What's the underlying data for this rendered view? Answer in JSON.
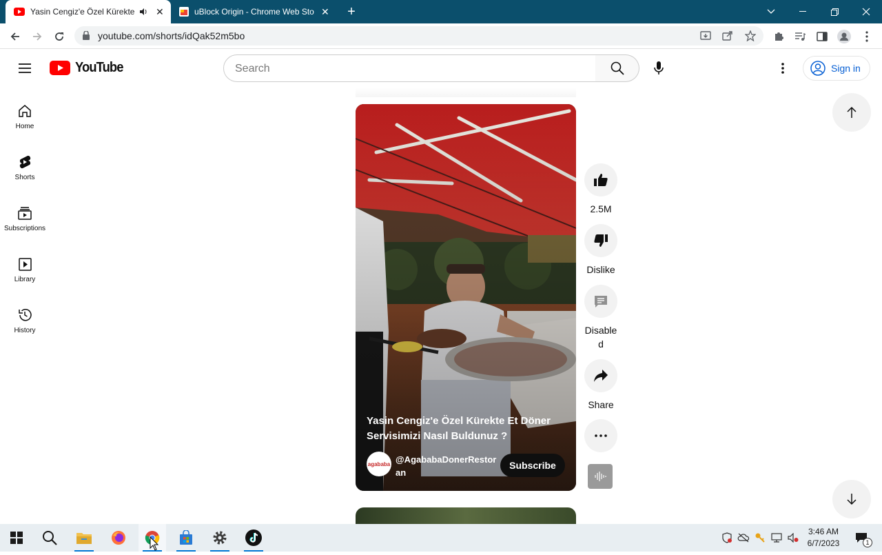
{
  "browser": {
    "tabs": [
      {
        "title": "Yasin Cengiz'e Özel Kürekte E",
        "active": true
      },
      {
        "title": "uBlock Origin - Chrome Web Sto",
        "active": false
      }
    ],
    "new_tab_label": "+",
    "url": "youtube.com/shorts/idQak52m5bo"
  },
  "youtube": {
    "logo_text": "YouTube",
    "search": {
      "placeholder": "Search",
      "value": ""
    },
    "signin_label": "Sign in",
    "guide": [
      {
        "label": "Home",
        "icon": "home-icon"
      },
      {
        "label": "Shorts",
        "icon": "shorts-icon"
      },
      {
        "label": "Subscriptions",
        "icon": "subscriptions-icon"
      },
      {
        "label": "Library",
        "icon": "library-icon"
      },
      {
        "label": "History",
        "icon": "history-icon"
      }
    ],
    "short": {
      "title": "Yasin Cengiz'e Özel Kürekte Et Döner Servisimizi Nasıl Buldunuz ?",
      "channel": "@AgababaDonerRestoran",
      "channel_avatar_text": "agababa",
      "subscribe_label": "Subscribe"
    },
    "actions": {
      "like_count": "2.5M",
      "dislike_label": "Dislike",
      "comments_label": "Disabled",
      "share_label": "Share"
    }
  },
  "taskbar": {
    "time": "3:46 AM",
    "date": "6/7/2023",
    "notification_count": "1"
  },
  "colors": {
    "tabstrip": "#0b4f6c",
    "youtube_red": "#ff0000",
    "signin_blue": "#065fd4",
    "subscribe_bg": "#0f0f0f"
  }
}
